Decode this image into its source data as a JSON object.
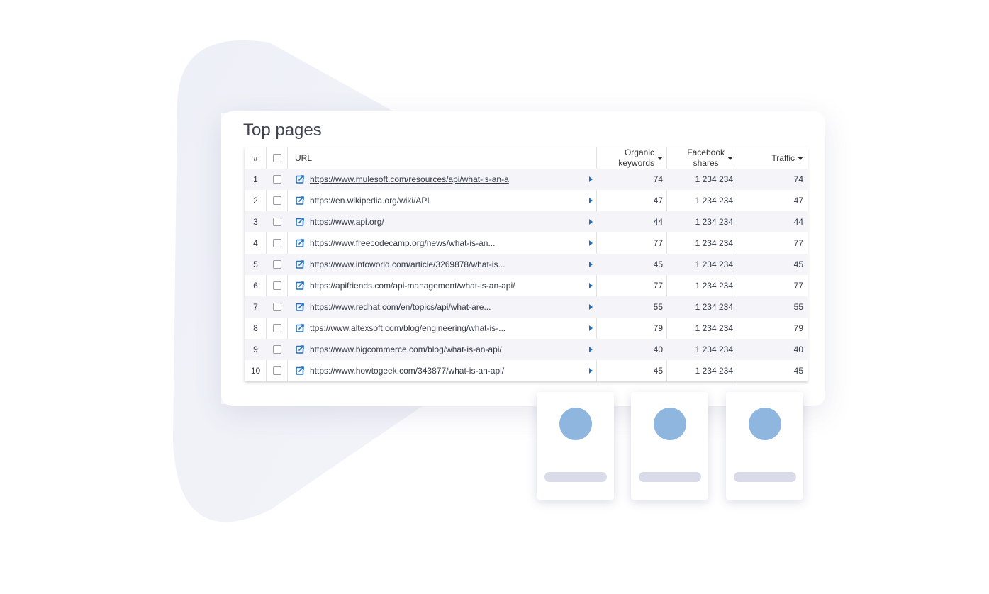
{
  "title": "Top pages",
  "table": {
    "headers": {
      "num": "#",
      "url": "URL",
      "keywords_line1": "Organic",
      "keywords_line2": "keywords",
      "shares_line1": "Facebook",
      "shares_line2": "shares",
      "traffic": "Traffic"
    },
    "rows": [
      {
        "n": "1",
        "url": "https://www.mulesoft.com/resources/api/what-is-an-a",
        "keywords": "74",
        "shares": "1 234 234",
        "traffic": "74"
      },
      {
        "n": "2",
        "url": "https://en.wikipedia.org/wiki/API",
        "keywords": "47",
        "shares": "1 234 234",
        "traffic": "47"
      },
      {
        "n": "3",
        "url": "https://www.api.org/",
        "keywords": "44",
        "shares": "1 234 234",
        "traffic": "44"
      },
      {
        "n": "4",
        "url": "https://www.freecodecamp.org/news/what-is-an...",
        "keywords": "77",
        "shares": "1 234 234",
        "traffic": "77"
      },
      {
        "n": "5",
        "url": "https://www.infoworld.com/article/3269878/what-is...",
        "keywords": "45",
        "shares": "1 234 234",
        "traffic": "45"
      },
      {
        "n": "6",
        "url": "https://apifriends.com/api-management/what-is-an-api/",
        "keywords": "77",
        "shares": "1 234 234",
        "traffic": "77"
      },
      {
        "n": "7",
        "url": "https://www.redhat.com/en/topics/api/what-are...",
        "keywords": "55",
        "shares": "1 234 234",
        "traffic": "55"
      },
      {
        "n": "8",
        "url": "ttps://www.altexsoft.com/blog/engineering/what-is-...",
        "keywords": "79",
        "shares": "1 234 234",
        "traffic": "79"
      },
      {
        "n": "9",
        "url": "https://www.bigcommerce.com/blog/what-is-an-api/",
        "keywords": "40",
        "shares": "1 234 234",
        "traffic": "40"
      },
      {
        "n": "10",
        "url": "https://www.howtogeek.com/343877/what-is-an-api/",
        "keywords": "45",
        "shares": "1 234 234",
        "traffic": "45"
      }
    ]
  },
  "icons": {
    "link": "external-link-icon",
    "expand": "expand-arrow-icon",
    "sort": "sort-caret-icon",
    "checkbox": "checkbox"
  },
  "colors": {
    "accent": "#1f6fc4",
    "avatar": "#8fb6df",
    "row_alt": "#f4f4f9",
    "title": "#3f4452"
  }
}
